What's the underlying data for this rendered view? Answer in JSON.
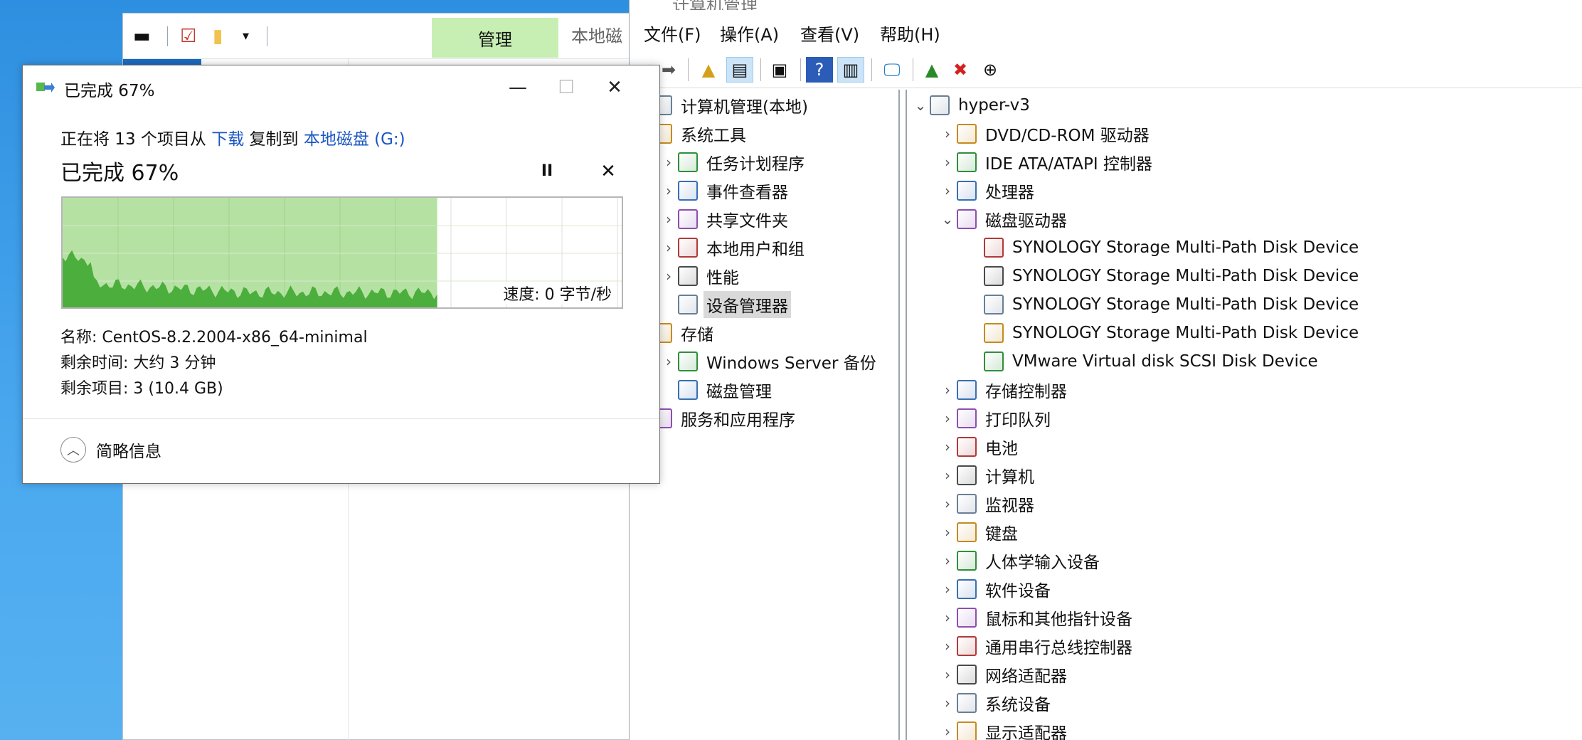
{
  "explorer": {
    "manage_tab": "管理",
    "local_tab": "本地磁"
  },
  "computer_management": {
    "title": "计算机管理",
    "menu": [
      "文件(F)",
      "操作(A)",
      "查看(V)",
      "帮助(H)"
    ],
    "left_tree": [
      {
        "label": "计算机管理(本地)",
        "level": 0,
        "expander": "",
        "icon": "computer-management-icon"
      },
      {
        "label": "系统工具",
        "level": 0,
        "expander": "",
        "icon": "tools-icon"
      },
      {
        "label": "任务计划程序",
        "level": 1,
        "expander": "›",
        "icon": "clock-icon"
      },
      {
        "label": "事件查看器",
        "level": 1,
        "expander": "›",
        "icon": "event-viewer-icon"
      },
      {
        "label": "共享文件夹",
        "level": 1,
        "expander": "›",
        "icon": "shared-folder-icon"
      },
      {
        "label": "本地用户和组",
        "level": 1,
        "expander": "›",
        "icon": "users-icon"
      },
      {
        "label": "性能",
        "level": 1,
        "expander": "›",
        "icon": "performance-icon"
      },
      {
        "label": "设备管理器",
        "level": 1,
        "expander": "",
        "icon": "device-manager-icon",
        "selected": true
      },
      {
        "label": "存储",
        "level": 0,
        "expander": "",
        "icon": "storage-icon"
      },
      {
        "label": "Windows Server 备份",
        "level": 1,
        "expander": "›",
        "icon": "backup-icon"
      },
      {
        "label": "磁盘管理",
        "level": 1,
        "expander": "",
        "icon": "disk-management-icon"
      },
      {
        "label": "服务和应用程序",
        "level": 0,
        "expander": "›",
        "icon": "services-icon"
      }
    ],
    "right_tree": [
      {
        "label": "hyper-v3",
        "level": 0,
        "expander": "⌄",
        "icon": "computer-icon"
      },
      {
        "label": "DVD/CD-ROM 驱动器",
        "level": 1,
        "expander": "›",
        "icon": "dvd-icon"
      },
      {
        "label": "IDE ATA/ATAPI 控制器",
        "level": 1,
        "expander": "›",
        "icon": "ide-icon"
      },
      {
        "label": "处理器",
        "level": 1,
        "expander": "›",
        "icon": "processor-icon"
      },
      {
        "label": "磁盘驱动器",
        "level": 1,
        "expander": "⌄",
        "icon": "disk-drive-icon"
      },
      {
        "label": "SYNOLOGY Storage  Multi-Path Disk Device",
        "level": 2,
        "expander": "",
        "icon": "disk-icon"
      },
      {
        "label": "SYNOLOGY Storage  Multi-Path Disk Device",
        "level": 2,
        "expander": "",
        "icon": "disk-icon"
      },
      {
        "label": "SYNOLOGY Storage  Multi-Path Disk Device",
        "level": 2,
        "expander": "",
        "icon": "disk-icon"
      },
      {
        "label": "SYNOLOGY Storage  Multi-Path Disk Device",
        "level": 2,
        "expander": "",
        "icon": "disk-icon"
      },
      {
        "label": "VMware Virtual disk SCSI Disk Device",
        "level": 2,
        "expander": "",
        "icon": "disk-icon"
      },
      {
        "label": "存储控制器",
        "level": 1,
        "expander": "›",
        "icon": "storage-controller-icon"
      },
      {
        "label": "打印队列",
        "level": 1,
        "expander": "›",
        "icon": "printer-icon"
      },
      {
        "label": "电池",
        "level": 1,
        "expander": "›",
        "icon": "battery-icon"
      },
      {
        "label": "计算机",
        "level": 1,
        "expander": "›",
        "icon": "computer-icon"
      },
      {
        "label": "监视器",
        "level": 1,
        "expander": "›",
        "icon": "monitor-icon"
      },
      {
        "label": "键盘",
        "level": 1,
        "expander": "›",
        "icon": "keyboard-icon"
      },
      {
        "label": "人体学输入设备",
        "level": 1,
        "expander": "›",
        "icon": "hid-icon"
      },
      {
        "label": "软件设备",
        "level": 1,
        "expander": "›",
        "icon": "software-device-icon"
      },
      {
        "label": "鼠标和其他指针设备",
        "level": 1,
        "expander": "›",
        "icon": "mouse-icon"
      },
      {
        "label": "通用串行总线控制器",
        "level": 1,
        "expander": "›",
        "icon": "usb-icon"
      },
      {
        "label": "网络适配器",
        "level": 1,
        "expander": "›",
        "icon": "network-adapter-icon"
      },
      {
        "label": "系统设备",
        "level": 1,
        "expander": "›",
        "icon": "system-device-icon"
      },
      {
        "label": "显示适配器",
        "level": 1,
        "expander": "›",
        "icon": "display-adapter-icon"
      }
    ]
  },
  "copy_dialog": {
    "title": "已完成 67%",
    "desc_prefix": "正在将 13 个项目从 ",
    "source": "下载",
    "desc_middle": " 复制到 ",
    "destination": "本地磁盘 (G:)",
    "percent_text": "已完成 67%",
    "progress": 0.67,
    "speed": "速度: 0 字节/秒",
    "name_line": "名称: CentOS-8.2.2004-x86_64-minimal",
    "time_line": "剩余时间: 大约 3 分钟",
    "items_line": "剩余项目: 3 (10.4 GB)",
    "less_info": "简略信息",
    "pause_glyph": "II",
    "cancel_glyph": "✕"
  },
  "colors": {
    "graph_done": "#b5e2a3",
    "graph_fill": "#4cae3c",
    "link": "#1a56c2",
    "manage_tab": "#c7efb3"
  }
}
